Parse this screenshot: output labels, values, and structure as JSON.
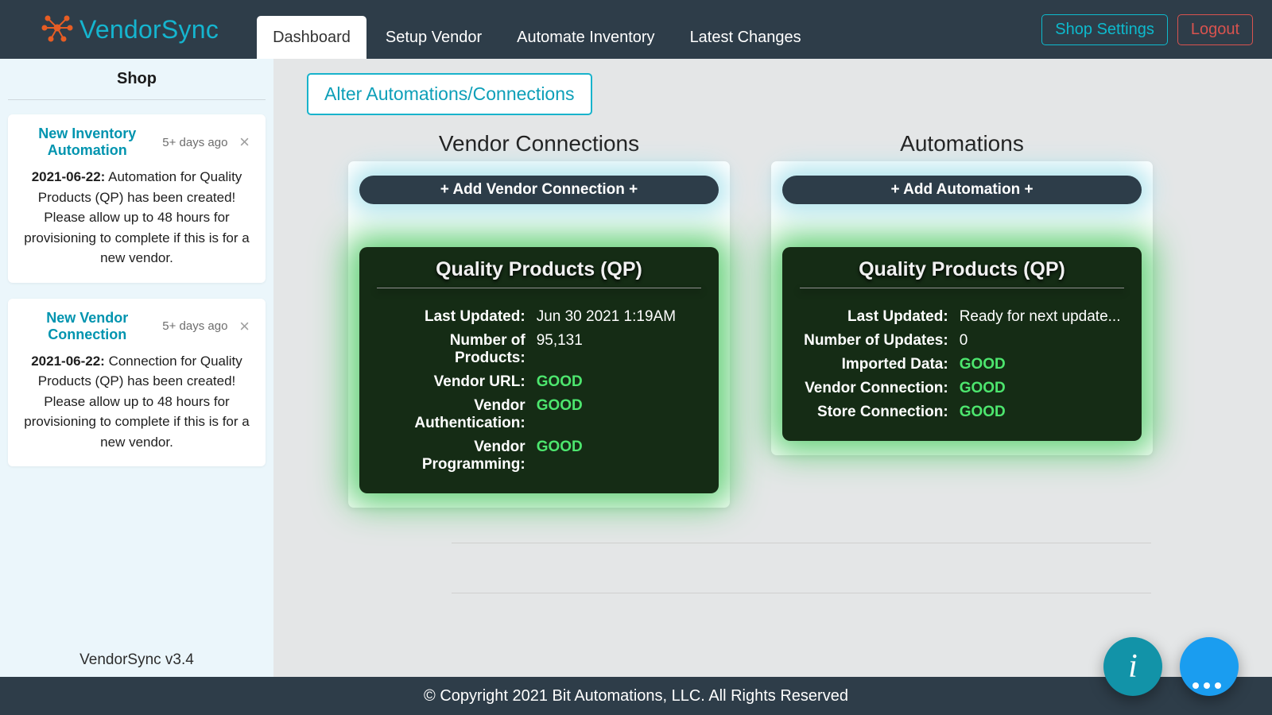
{
  "brand": {
    "name": "VendorSync"
  },
  "nav": {
    "tabs": [
      "Dashboard",
      "Setup Vendor",
      "Automate Inventory",
      "Latest Changes"
    ],
    "active_index": 0,
    "settings": "Shop Settings",
    "logout": "Logout"
  },
  "sidebar": {
    "title": "Shop",
    "version": "VendorSync v3.4",
    "notes": [
      {
        "title": "New Inventory Automation",
        "age": "5+ days ago",
        "date": "2021-06-22:",
        "body": "Automation for Quality Products (QP) has been created! Please allow up to 48 hours for provisioning to complete if this is for a new vendor."
      },
      {
        "title": "New Vendor Connection",
        "age": "5+ days ago",
        "date": "2021-06-22:",
        "body": "Connection for Quality Products (QP) has been created! Please allow up to 48 hours for provisioning to complete if this is for a new vendor."
      }
    ]
  },
  "main": {
    "alter_button": "Alter Automations/Connections",
    "vendor_panel": {
      "title": "Vendor Connections",
      "add_label": "+ Add Vendor Connection +",
      "card_title": "Quality Products (QP)",
      "rows": {
        "last_updated_label": "Last Updated:",
        "last_updated": "Jun 30 2021 1:19AM",
        "num_products_label": "Number of Products:",
        "num_products": "95,131",
        "vendor_url_label": "Vendor URL:",
        "vendor_url": "GOOD",
        "vendor_auth_label": "Vendor Authentication:",
        "vendor_auth": "GOOD",
        "vendor_prog_label": "Vendor Programming:",
        "vendor_prog": "GOOD"
      }
    },
    "auto_panel": {
      "title": "Automations",
      "add_label": "+ Add Automation +",
      "card_title": "Quality Products (QP)",
      "rows": {
        "last_updated_label": "Last Updated:",
        "last_updated": "Ready for next update...",
        "num_updates_label": "Number of Updates:",
        "num_updates": "0",
        "imported_label": "Imported Data:",
        "imported": "GOOD",
        "vendor_conn_label": "Vendor Connection:",
        "vendor_conn": "GOOD",
        "store_conn_label": "Store Connection:",
        "store_conn": "GOOD"
      }
    }
  },
  "footer": {
    "copyright": "© Copyright 2021 Bit Automations, LLC. All Rights Reserved"
  },
  "fab": {
    "info": "i"
  }
}
